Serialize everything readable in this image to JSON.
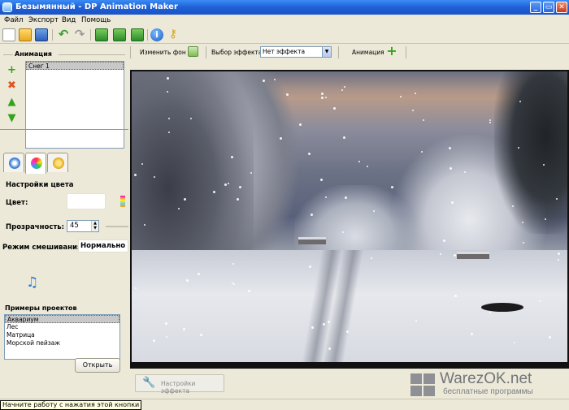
{
  "window": {
    "title": "Безымянный - DP Animation Maker",
    "minimize": "_",
    "maximize": "▭",
    "close": "✕"
  },
  "menu": {
    "items": [
      "Файл",
      "Экспорт",
      "Вид",
      "Помощь"
    ]
  },
  "toolbar": {
    "buttons": [
      "new-icon",
      "open-folder-icon",
      "save-icon",
      "undo-icon",
      "redo-icon",
      "export-icon",
      "export-image-icon",
      "export-exe-icon",
      "info-icon",
      "key-icon"
    ],
    "info_label": "i"
  },
  "animation_panel": {
    "title": "Анимация",
    "items": [
      {
        "label": "Снег 1",
        "selected": true
      }
    ]
  },
  "color_settings": {
    "title": "Настройки цвета",
    "color_label": "Цвет:",
    "opacity_label": "Прозрачность:",
    "opacity_value": "45",
    "blend_label": "Режим смешивания",
    "blend_value": "Нормально"
  },
  "examples": {
    "title": "Примеры проектов",
    "items": [
      "Аквариум",
      "Лес",
      "Матрица",
      "Морской пейзаж"
    ],
    "selected": "Аквариум",
    "open_button": "Открыть"
  },
  "effect_bar": {
    "change_bg": "Изменить фон",
    "choose_effect": "Выбор эффекта",
    "effect_value": "Нет эффекта",
    "animation": "Анимация"
  },
  "effect_settings_button": "Настройки эффекта",
  "watermark": {
    "title": "WarezOK.net",
    "subtitle": "бесплатные программы"
  },
  "status": {
    "tip": "Начните работу с нажатия этой кнопки"
  },
  "colors": {
    "titlebar": "#1f5fd6",
    "panel": "#ece9d8",
    "accent_green": "#35a31c",
    "delete_red": "#e0531f"
  }
}
